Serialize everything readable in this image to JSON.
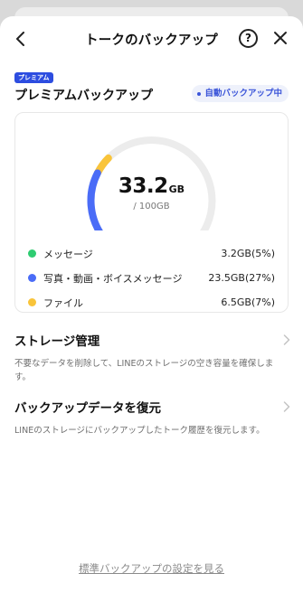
{
  "header": {
    "title": "トークのバックアップ",
    "help_glyph": "?"
  },
  "premium": {
    "badge": "プレミアム",
    "title": "プレミアムバックアップ",
    "status": "自動バックアップ中"
  },
  "storage": {
    "used_value": "33.2",
    "used_unit": "GB",
    "total": "/ 100GB",
    "used_fraction": 0.332
  },
  "chart_data": {
    "type": "pie",
    "categories": [
      "メッセージ",
      "写真・動画・ボイスメッセージ",
      "ファイル"
    ],
    "values": [
      3.2,
      23.5,
      6.5
    ],
    "percent_labels": [
      "5%",
      "27%",
      "7%"
    ],
    "total": 100,
    "colors": [
      "#2ecc71",
      "#4a6cf7",
      "#f9c43a"
    ],
    "track_color": "#ececec"
  },
  "legend": [
    {
      "label": "メッセージ",
      "value": "3.2GB(5%)",
      "color": "#2ecc71"
    },
    {
      "label": "写真・動画・ボイスメッセージ",
      "value": "23.5GB(27%)",
      "color": "#4a6cf7"
    },
    {
      "label": "ファイル",
      "value": "6.5GB(7%)",
      "color": "#f9c43a"
    }
  ],
  "sections": {
    "storage_manage": {
      "title": "ストレージ管理",
      "desc": "不要なデータを削除して、LINEのストレージの空き容量を確保します。"
    },
    "restore": {
      "title": "バックアップデータを復元",
      "desc": "LINEのストレージにバックアップしたトーク履歴を復元します。"
    }
  },
  "footer": {
    "link": "標準バックアップの設定を見る"
  }
}
